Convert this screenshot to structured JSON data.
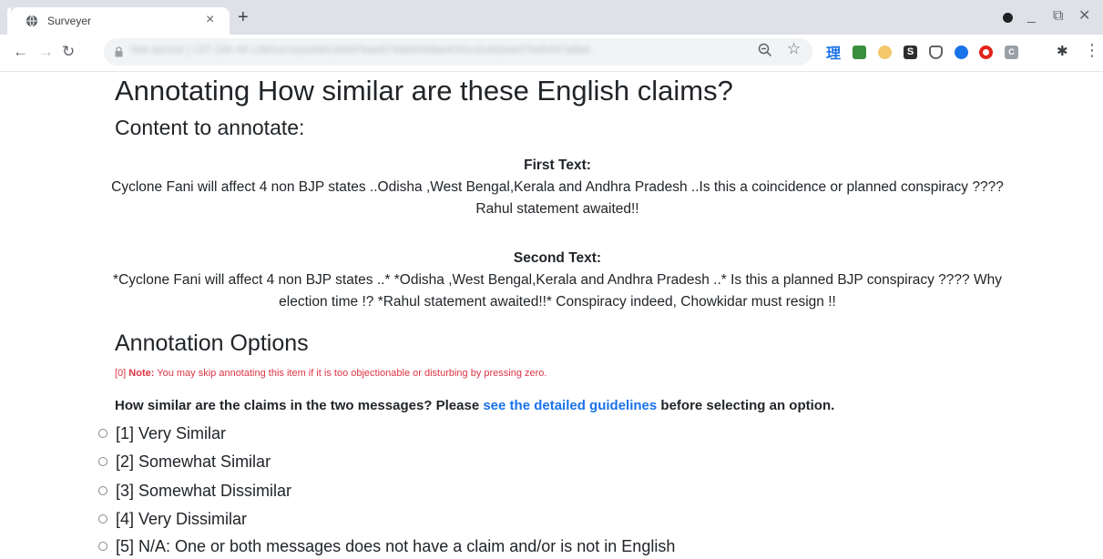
{
  "browser": {
    "tab_title": "Surveyer",
    "tab_close": "×",
    "new_tab": "+",
    "url": "Not secure | 137.230.49.136/surveys/6d130087bae673d65046be4/3f1c0cd1bae07bd5437a8b6",
    "icons": [
      "globe-icon",
      "back-icon",
      "forward-icon",
      "reload-icon",
      "lock-icon",
      "zoom-icon",
      "star-icon",
      "extensions-icon",
      "menu-icon"
    ],
    "extension_labels": {
      "kanji": "理",
      "s": "S",
      "c": "C",
      "puzzle": "✱"
    },
    "window_controls": {
      "minimize": "_",
      "restore": "⧉",
      "close": "✕"
    }
  },
  "page": {
    "title": "Annotating How similar are these English claims?",
    "content_heading": "Content to annotate:",
    "first_label": "First Text:",
    "first_text": "Cyclone Fani will affect 4 non BJP states ..Odisha ,West Bengal,Kerala and Andhra Pradesh ..Is this a coincidence or planned conspiracy ???? Rahul statement awaited!!",
    "second_label": "Second Text:",
    "second_text": "*Cyclone Fani will affect 4 non BJP states ..* *Odisha ,West Bengal,Kerala and Andhra Pradesh ..* Is this a planned BJP conspiracy ???? Why election time !? *Rahul statement awaited!!* Conspiracy indeed, Chowkidar must resign !!",
    "options_heading": "Annotation Options",
    "note_prefix": "[0]",
    "note_label": "Note:",
    "note_text": "You may skip annotating this item if it is too objectionable or disturbing by pressing zero.",
    "question_before": "How similar are the claims in the two messages? Please",
    "question_link": "see the detailed guidelines",
    "question_after": "before selecting an option.",
    "options": [
      "[1] Very Similar",
      "[2] Somewhat Similar",
      "[3] Somewhat Dissimilar",
      "[4] Very Dissimilar",
      "[5] N/A: One or both messages does not have a claim and/or is not in English"
    ]
  },
  "colors": {
    "note": "#dc3545",
    "link": "#1a73e8",
    "tabbar": "#dee1e6"
  }
}
